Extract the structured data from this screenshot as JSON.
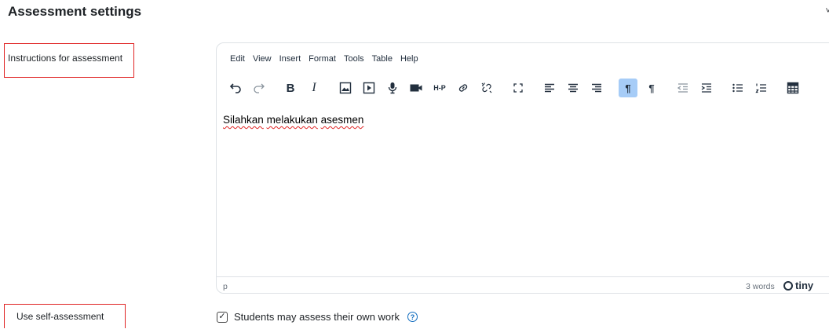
{
  "section": {
    "title": "Assessment settings",
    "collapse_icon": "chevron-down-icon"
  },
  "labels": {
    "instructions": "Instructions for assessment",
    "self_assessment": "Use self-assessment"
  },
  "editor": {
    "menu": [
      "Edit",
      "View",
      "Insert",
      "Format",
      "Tools",
      "Table",
      "Help"
    ],
    "content": [
      "Silahkan",
      "melakukan",
      "asesmen"
    ],
    "status_path": "p",
    "word_count": "3 words",
    "brand": "tiny"
  },
  "self_assessment": {
    "checkbox_label": "Students may assess their own work",
    "checked": true
  }
}
